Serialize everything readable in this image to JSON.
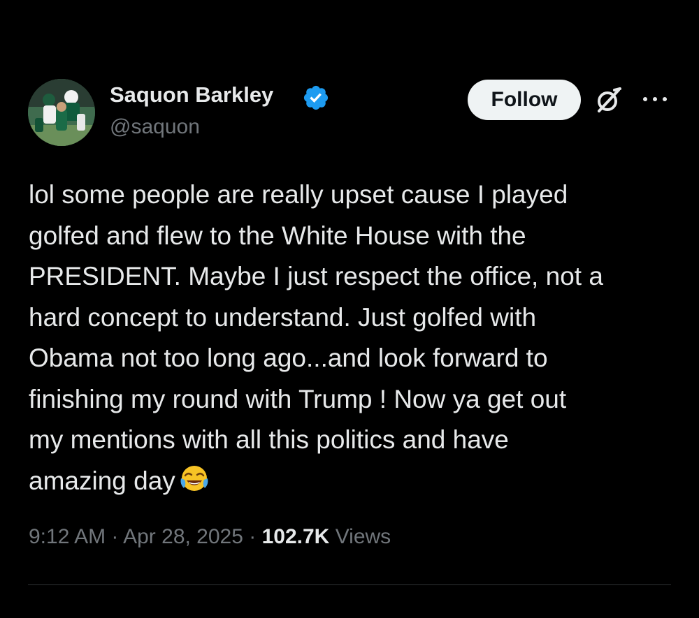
{
  "author": {
    "display_name": "Saquon Barkley",
    "handle": "@saquon",
    "verified": true
  },
  "actions": {
    "follow_label": "Follow",
    "grok_icon": "grok-icon",
    "more_icon": "more-icon"
  },
  "tweet": {
    "lines": [
      "lol some people are really upset cause I played",
      "golfed and flew to the White House with the",
      "PRESIDENT. Maybe I just respect the office, not a",
      "hard concept to understand. Just golfed with",
      "Obama not too long ago...and look forward to",
      "finishing my round with Trump ! Now ya get out",
      "my mentions with all this politics and have",
      "amazing day"
    ],
    "emoji": "face-with-tears-of-joy"
  },
  "meta": {
    "time": "9:12 AM",
    "separator": "·",
    "date": "Apr 28, 2025",
    "views_count": "102.7K",
    "views_label": "Views"
  },
  "colors": {
    "background": "#000000",
    "text_primary": "#e7e9ea",
    "text_secondary": "#71767b",
    "verified_blue": "#1d9bf0",
    "follow_bg": "#eff3f4",
    "divider": "#2f3336"
  }
}
